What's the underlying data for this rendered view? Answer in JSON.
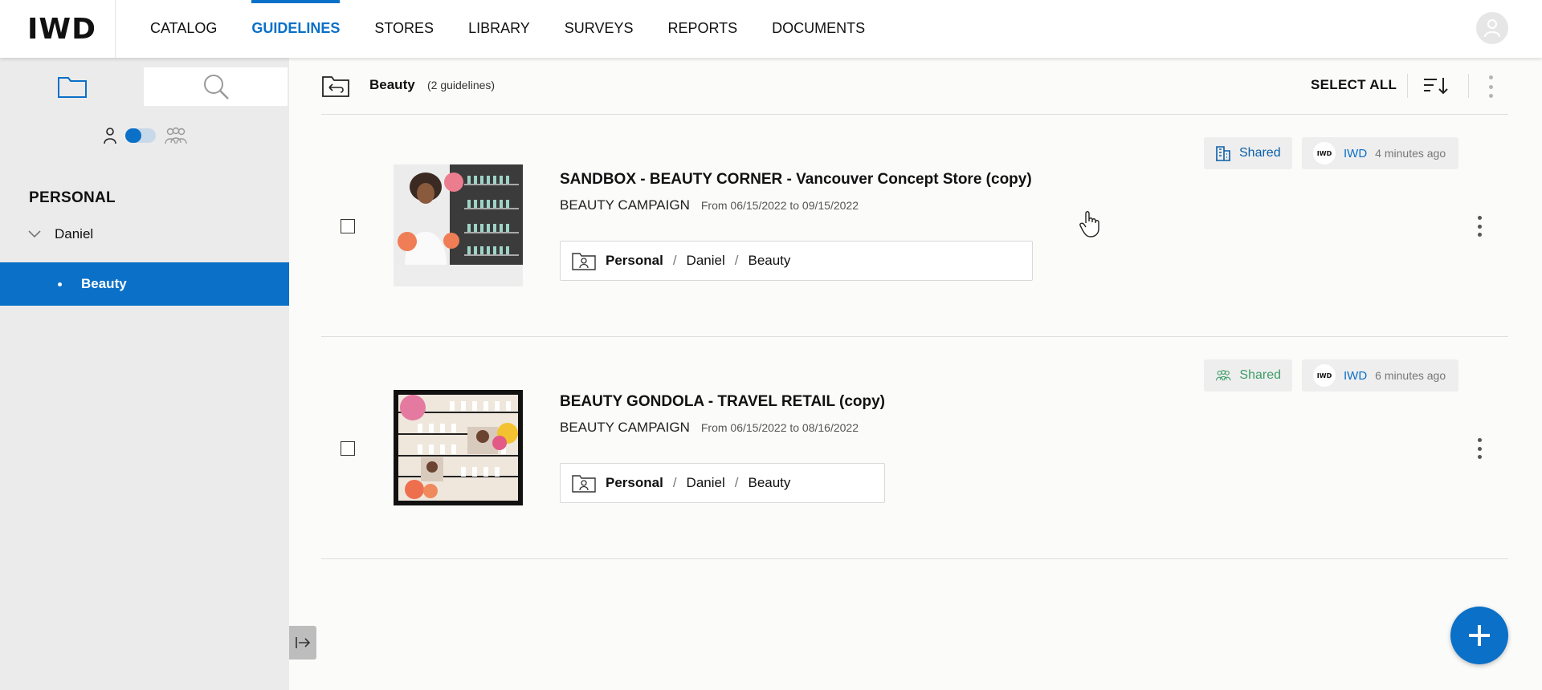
{
  "brand": {
    "logo_text": "IWD"
  },
  "nav": {
    "items": [
      {
        "label": "CATALOG",
        "active": false
      },
      {
        "label": "GUIDELINES",
        "active": true
      },
      {
        "label": "STORES",
        "active": false
      },
      {
        "label": "LIBRARY",
        "active": false
      },
      {
        "label": "SURVEYS",
        "active": false
      },
      {
        "label": "REPORTS",
        "active": false
      },
      {
        "label": "DOCUMENTS",
        "active": false
      }
    ],
    "avatar_icon": "user-icon"
  },
  "sidebar": {
    "tabs": [
      {
        "icon": "folder-icon",
        "active": true
      },
      {
        "icon": "search-icon",
        "active": false
      }
    ],
    "mode_toggle": {
      "left_icon": "person-icon",
      "right_icon": "group-icon",
      "state": "personal"
    },
    "section_title": "PERSONAL",
    "folder": {
      "label": "Daniel",
      "expanded": true
    },
    "subfolder": {
      "label": "Beauty",
      "selected": true
    }
  },
  "content_header": {
    "folder_name": "Beauty",
    "count_text": "(2 guidelines)",
    "select_all_label": "SELECT ALL",
    "sort_icon": "sort-descending-icon",
    "more_icon": "more-vertical-icon"
  },
  "guidelines": [
    {
      "title": "SANDBOX - BEAUTY CORNER - Vancouver Concept Store (copy)",
      "campaign": "BEAUTY CAMPAIGN",
      "dates": "From 06/15/2022 to 09/15/2022",
      "path": [
        "Personal",
        "Daniel",
        "Beauty"
      ],
      "shared_label": "Shared",
      "shared_icon": "building-icon",
      "owner": "IWD",
      "owner_logo_text": "IWD",
      "time": "4 minutes ago"
    },
    {
      "title": "BEAUTY GONDOLA - TRAVEL RETAIL (copy)",
      "campaign": "BEAUTY CAMPAIGN",
      "dates": "From 06/15/2022 to 08/16/2022",
      "path": [
        "Personal",
        "Daniel",
        "Beauty"
      ],
      "shared_label": "Shared",
      "shared_icon": "group-icon",
      "owner": "IWD",
      "owner_logo_text": "IWD",
      "time": "6 minutes ago"
    }
  ],
  "colors": {
    "accent": "#0a70c8",
    "shared_blue": "#0a5ea8",
    "shared_green": "#3c9c66"
  }
}
